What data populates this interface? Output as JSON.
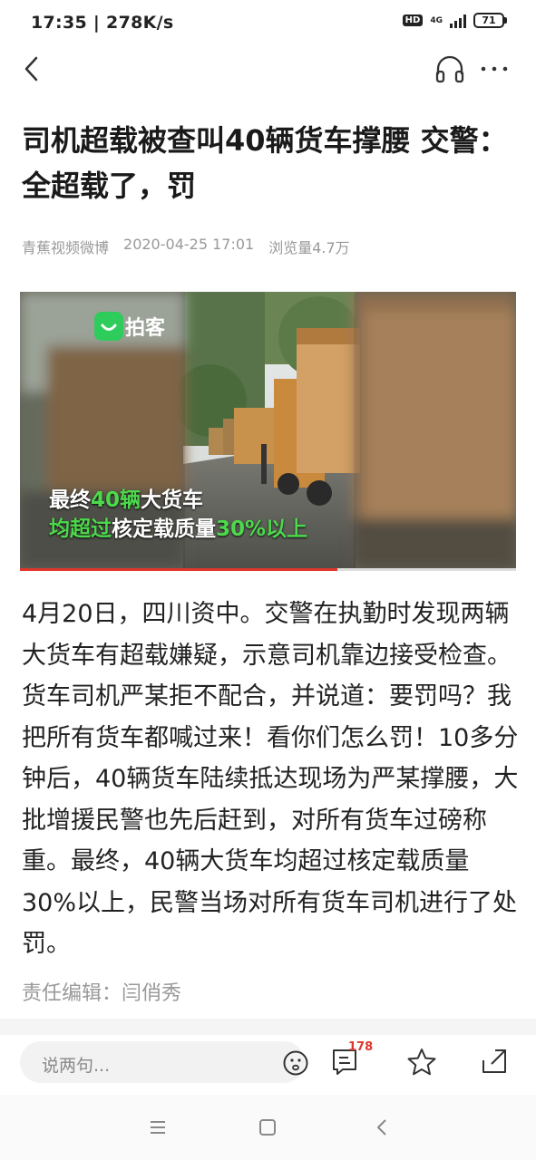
{
  "status_bar": {
    "time_speed": "17:35 | 278K/s",
    "hd": "HD",
    "network": "4G",
    "battery": "71"
  },
  "nav": {
    "back_icon": "chevron-left-icon",
    "audio_icon": "headphones-icon",
    "more_icon": "more-dots-icon"
  },
  "article": {
    "title": "司机超载被查叫40辆货车撑腰 交警：全超载了，罚",
    "source": "青蕉视频微博",
    "date": "2020-04-25 17:01",
    "views": "浏览量4.7万",
    "body": "4月20日，四川资中。交警在执勤时发现两辆大货车有超载嫌疑，示意司机靠边接受检查。 货车司机严某拒不配合，并说道：要罚吗？我把所有货车都喊过来！看你们怎么罚！10多分钟后，40辆货车陆续抵达现场为严某撑腰，大批增援民警也先后赶到，对所有货车过磅称重。最终，40辆大货车均超过核定载质量30%以上，民警当场对所有货车司机进行了处罚。",
    "editor": "责任编辑：闫俏秀"
  },
  "video": {
    "logo_text": "拍客",
    "caption_line1": {
      "a": "最终",
      "b": "40辆",
      "c": "大货车"
    },
    "caption_line2": {
      "a": "均超过",
      "b": "核定载质量",
      "c": "30%以上"
    },
    "progress": 0.64,
    "highlight_color": "#4cd94c"
  },
  "bottom_bar": {
    "comment_placeholder": "说两句...",
    "comment_count": "178",
    "accent_color": "#e0352b"
  },
  "system_nav": {
    "menu_icon": "menu-icon",
    "home_icon": "home-square-icon",
    "back_icon": "back-triangle-icon"
  }
}
